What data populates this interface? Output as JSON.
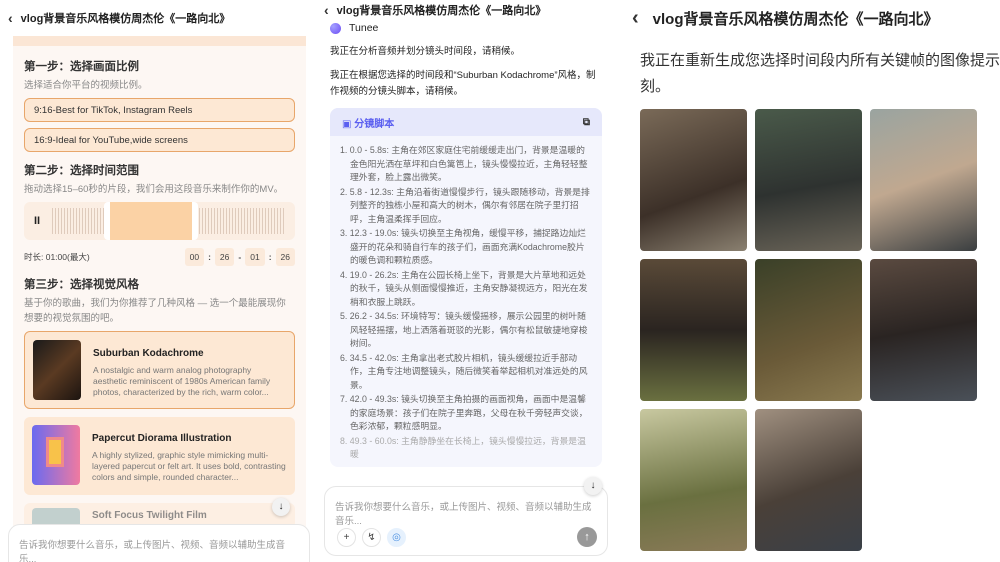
{
  "title": "vlog背景音乐风格模仿周杰伦《一路向北》",
  "panel1": {
    "step1": {
      "title": "第一步：选择画面比例",
      "desc": "选择适合你平台的视频比例。",
      "options": [
        "9:16-Best for TikTok, Instagram Reels",
        "16:9-Ideal for YouTube,wide screens"
      ]
    },
    "step2": {
      "title": "第二步：选择时间范围",
      "desc": "拖动选择15–60秒的片段，我们会用这段音乐来制作你的MV。",
      "duration": "时长: 01:00(最大)",
      "start_min": "00",
      "start_sec": "26",
      "end_min": "01",
      "end_sec": "26",
      "sep": ":",
      "dash": "-"
    },
    "step3": {
      "title": "第三步：选择视觉风格",
      "desc": "基于你的歌曲，我们为你推荐了几种风格 — 选一个最能展现你想要的视觉氛围的吧。",
      "styles": [
        {
          "name": "Suburban Kodachrome",
          "desc": "A nostalgic and warm analog photography aesthetic reminiscent of 1980s American family photos, characterized by the rich, warm color..."
        },
        {
          "name": "Papercut Diorama Illustration",
          "desc": "A highly stylized, graphic style mimicking multi-layered papercut or felt art. It uses bold, contrasting colors and simple, rounded character..."
        },
        {
          "name": "Soft Focus Twilight Film",
          "desc": ""
        }
      ]
    },
    "input_placeholder": "告诉我你想要什么音乐，或上传图片、视频、音频以辅助生成音乐..."
  },
  "panel2": {
    "assistant": "Tunee",
    "msg1": "我正在分析音频并划分镜头时间段，请稍候。",
    "msg2": "我正在根据您选择的时间段和“Suburban Kodachrome”风格，制作视频的分镜头脚本，请稍候。",
    "script_title": "分镜脚本",
    "items": [
      "1. 0.0 - 5.8s: 主角在郊区家庭住宅前缓缓走出门，背景是温暖的金色阳光洒在草坪和白色篱笆上，镜头慢慢拉近，主角轻轻整理外套，脸上露出微笑。",
      "2. 5.8 - 12.3s: 主角沿着街道慢慢步行，镜头跟随移动，背景是排列整齐的独栋小屋和高大的树木，偶尔有邻居在院子里打招呼，主角温柔挥手回应。",
      "3. 12.3 - 19.0s: 镜头切换至主角视角，缓慢平移，捕捉路边灿烂盛开的花朵和骑自行车的孩子们，画面充满Kodachrome胶片的暖色调和颗粒质感。",
      "4. 19.0 - 26.2s: 主角在公园长椅上坐下，背景是大片草地和远处的秋千，镜头从侧面慢慢推近，主角安静凝视远方，阳光在发梢和衣服上跳跃。",
      "5. 26.2 - 34.5s: 环境特写：镜头缓慢摇移，展示公园里的树叶随风轻轻摇摆，地上洒落着斑驳的光影，偶尔有松鼠敏捷地穿梭树间。",
      "6. 34.5 - 42.0s: 主角拿出老式胶片相机，镜头缓缓拉近手部动作，主角专注地调整镜头，随后微笑着举起相机对准远处的风景。",
      "7. 42.0 - 49.3s: 镜头切换至主角拍摄的画面视角，画面中是温馨的家庭场景：孩子们在院子里奔跑，父母在秋千旁轻声交谈，色彩浓郁，颗粒感明显。",
      "8. 49.3 - 60.0s: 主角静静坐在长椅上，镜头慢慢拉远，背景是温暖"
    ],
    "input_placeholder": "告诉我你想要什么音乐，或上传图片、视频、音频以辅助生成音乐..."
  },
  "panel3": {
    "msg_line1": "我正在重新生成您选择时间段内所有关键帧的图像提示，",
    "msg_line2": "刻。",
    "images": 8
  },
  "colors": {
    "accent": "#e8a66a",
    "accent_bg": "#fde8d4",
    "script_accent": "#5b5ff0"
  }
}
